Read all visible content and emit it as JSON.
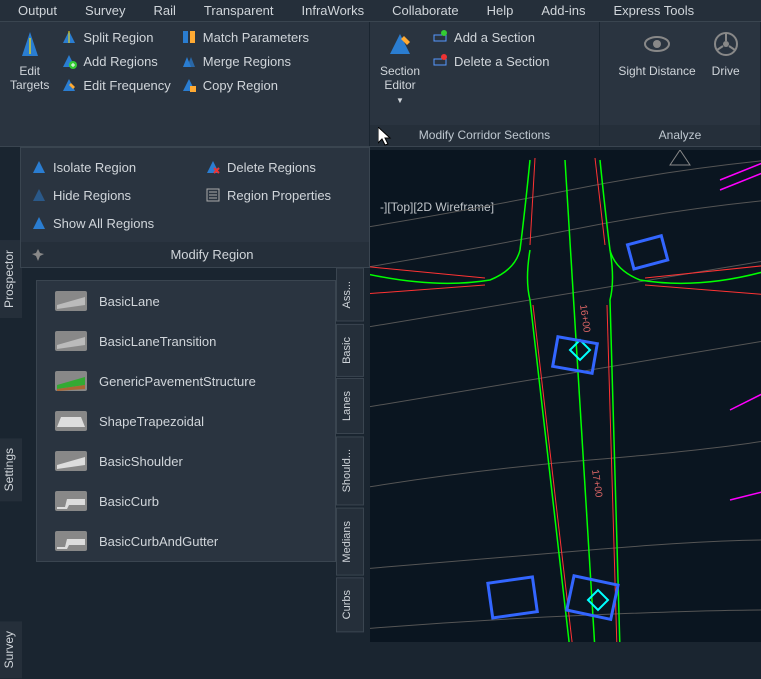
{
  "menu": [
    "Output",
    "Survey",
    "Rail",
    "Transparent",
    "InfraWorks",
    "Collaborate",
    "Help",
    "Add-ins",
    "Express Tools"
  ],
  "ribbon": {
    "p1": {
      "big": "Edit\nTargets",
      "rows": [
        [
          "Split Region",
          "Match Parameters"
        ],
        [
          "Add Regions",
          "Merge Regions"
        ],
        [
          "Edit Frequency",
          "Copy Region"
        ]
      ]
    },
    "p2": {
      "big": "Section\nEditor",
      "rows": [
        "Add a Section",
        "Delete a Section"
      ],
      "label": "Modify Corridor Sections"
    },
    "p3": {
      "b1": "Sight Distance",
      "b2": "Drive",
      "label": "Analyze"
    }
  },
  "dropdown": {
    "items": [
      "Isolate Region",
      "Delete Regions",
      "Hide Regions",
      "Region Properties",
      "Show All Regions"
    ],
    "footer": "Modify Region"
  },
  "sidetabs": [
    "Prospector",
    "Settings",
    "Survey"
  ],
  "asm": {
    "items": [
      "BasicLane",
      "BasicLaneTransition",
      "GenericPavementStructure",
      "ShapeTrapezoidal",
      "BasicShoulder",
      "BasicCurb",
      "BasicCurbAndGutter"
    ],
    "tabs": [
      "Ass...",
      "Basic",
      "Lanes",
      "Should...",
      "Medians",
      "Curbs"
    ]
  },
  "viewport": {
    "label": "-][Top][2D Wireframe]",
    "station1": "16+00",
    "station2": "17+00"
  }
}
